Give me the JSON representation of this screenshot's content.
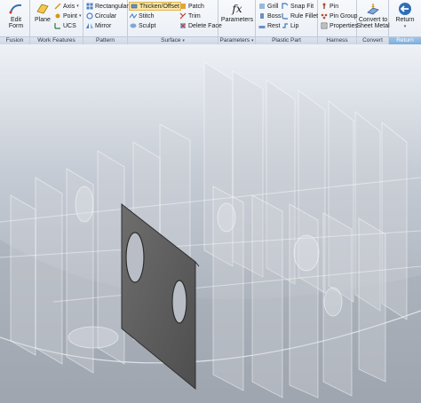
{
  "ribbon": {
    "fusion": {
      "edit_form": "Edit\nForm",
      "title": "Fusion"
    },
    "work_features": {
      "plane": "Plane",
      "axis": "Axis",
      "point": "Point",
      "ucs": "UCS",
      "title": "Work Features"
    },
    "pattern": {
      "rectangular": "Rectangular",
      "circular": "Circular",
      "mirror": "Mirror",
      "title": "Pattern"
    },
    "surface": {
      "thicken_offset": "Thicken/Offset",
      "stitch": "Stitch",
      "sculpt": "Sculpt",
      "patch": "Patch",
      "trim": "Trim",
      "delete_face": "Delete Face",
      "title": "Surface"
    },
    "parameters": {
      "parameters": "Parameters",
      "fx": "fx",
      "title": "Parameters"
    },
    "plastic_part": {
      "grill": "Grill",
      "boss": "Boss",
      "rest": "Rest",
      "snap_fit": "Snap Fit",
      "rule_fillet": "Rule Fillet",
      "lip": "Lip",
      "title": "Plastic Part"
    },
    "harness": {
      "pin": "Pin",
      "pin_group": "Pin Group",
      "properties": "Properties",
      "title": "Harness"
    },
    "convert": {
      "convert_to_sheet_metal": "Convert to\nSheet Metal",
      "title": "Convert"
    },
    "return": {
      "return": "Return",
      "title": "Return"
    }
  },
  "colors": {
    "ribbon_bg": "#eef2f7",
    "selected_plate": "#5c5c5c",
    "ghost_part": "#c8ccd3",
    "pressed_button": "#fde7a4"
  }
}
